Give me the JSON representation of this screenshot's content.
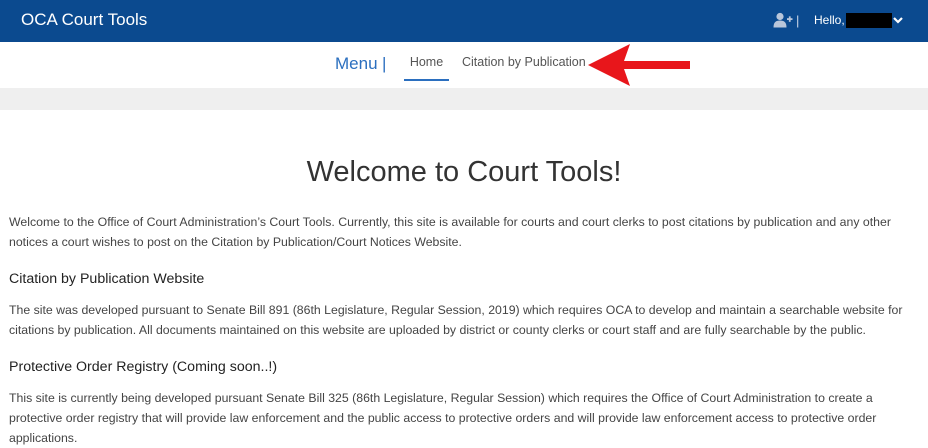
{
  "header": {
    "brand": "OCA Court Tools",
    "separator": "|",
    "greeting": "Hello,",
    "icons": {
      "add_user": "add-user-icon",
      "chevron": "chevron-down-icon"
    },
    "bg_color": "#0b4a8f"
  },
  "nav": {
    "menu_label": "Menu",
    "menu_separator": "|",
    "items": [
      {
        "label": "Home",
        "active": true
      },
      {
        "label": "Citation by Publication",
        "active": false
      }
    ],
    "accent_color": "#2b6fbf"
  },
  "annotation": {
    "arrow_color": "#e8161b"
  },
  "main": {
    "title": "Welcome to Court Tools!",
    "intro": "Welcome to the Office of Court Administration’s Court Tools. Currently, this site is available for courts and court clerks to post citations by publication and any other notices a court wishes to post on the Citation by Publication/Court Notices Website.",
    "sections": [
      {
        "heading": "Citation by Publication Website",
        "body": "The site was developed pursuant to Senate Bill 891 (86th Legislature, Regular Session, 2019) which requires OCA to develop and maintain a searchable website for citations by publication. All documents maintained on this website are uploaded by district or county clerks or court staff and are fully searchable by the public."
      },
      {
        "heading": "Protective Order Registry (Coming soon..!)",
        "body": "This site is currently being developed pursuant Senate Bill 325 (86th Legislature, Regular Session) which requires the Office of Court Administration to create a protective order registry that will provide law enforcement and the public access to protective orders and will provide law enforcement access to protective order applications."
      }
    ]
  }
}
